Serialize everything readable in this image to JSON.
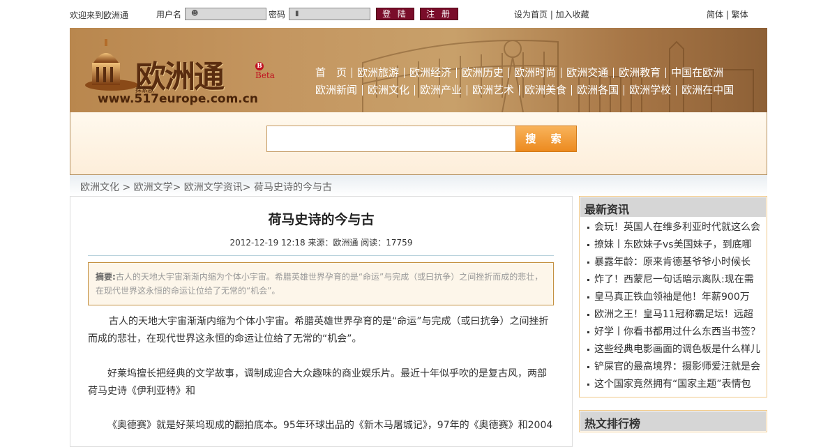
{
  "topbar": {
    "welcome": "欢迎来到欧洲通",
    "username_label": "用户名",
    "password_label": "密码",
    "login_label": "登 陆",
    "register_label": "注 册",
    "home_links": "设为首页 | 加入收藏",
    "lang_links": "简体 | 繁体"
  },
  "logo": {
    "name": "欧洲通",
    "small": "探索欧",
    "url": "www.517europe.com.cn",
    "beta": "Beta"
  },
  "nav": {
    "row1": [
      "首　页",
      "欧洲旅游",
      "欧洲经济",
      "欧洲历史",
      "欧洲时尚",
      "欧洲交通",
      "欧洲教育",
      "中国在欧洲"
    ],
    "row2": [
      "欧洲新闻",
      "欧洲文化",
      "欧洲产业",
      "欧洲艺术",
      "欧洲美食",
      "欧洲各国",
      "欧洲学校",
      "欧洲在中国"
    ]
  },
  "search": {
    "button_label": "搜 索",
    "placeholder": ""
  },
  "breadcrumb": "欧洲文化 > 欧洲文学> 欧洲文学资讯> 荷马史诗的今与古",
  "article": {
    "title": "荷马史诗的今与古",
    "meta": "2012-12-19 12:18  来源：欧洲通   阅读：17759",
    "summary_label": "摘要:",
    "summary": "古人的天地大宇宙渐渐内缩为个体小宇宙。希腊英雄世界孕育的是“命运”与完成（或曰抗争）之间挫折而成的悲壮，在现代世界这永恒的命运让位给了无常的“机会”。",
    "paragraphs": [
      "古人的天地大宇宙渐渐内缩为个体小宇宙。希腊英雄世界孕育的是“命运”与完成（或曰抗争）之间挫折而成的悲壮，在现代世界这永恒的命运让位给了无常的“机会”。",
      "好莱坞擅长把经典的文学故事，调制成迎合大众趣味的商业娱乐片。最近十年似乎吹的是复古风，两部荷马史诗《伊利亚特》和",
      "《奥德赛》就是好莱坞现成的翻拍底本。95年环球出品的《新木马屠城记》，97年的《奥德赛》和2004"
    ]
  },
  "sidebar": {
    "latest_title": "最新资讯",
    "latest": [
      "会玩！英国人在维多利亚时代就这么会",
      "撩妹丨东欧妹子vs美国妹子，到底哪",
      "暴露年龄：原来肯德基爷爷小时候长",
      "炸了！西蒙尼一句话暗示离队:现在需",
      "皇马真正铁血领袖是他！年薪900万",
      "欧洲之王！皇马11冠称霸足坛！远超",
      "好学丨你看书都用过什么东西当书签？",
      "这些经典电影画面的调色板是什么样儿",
      "铲屎官的最高境界：摄影师爱汪就是会",
      "这个国家竟然拥有“国家主题”表情包"
    ],
    "hot_title": "热文排行榜"
  }
}
